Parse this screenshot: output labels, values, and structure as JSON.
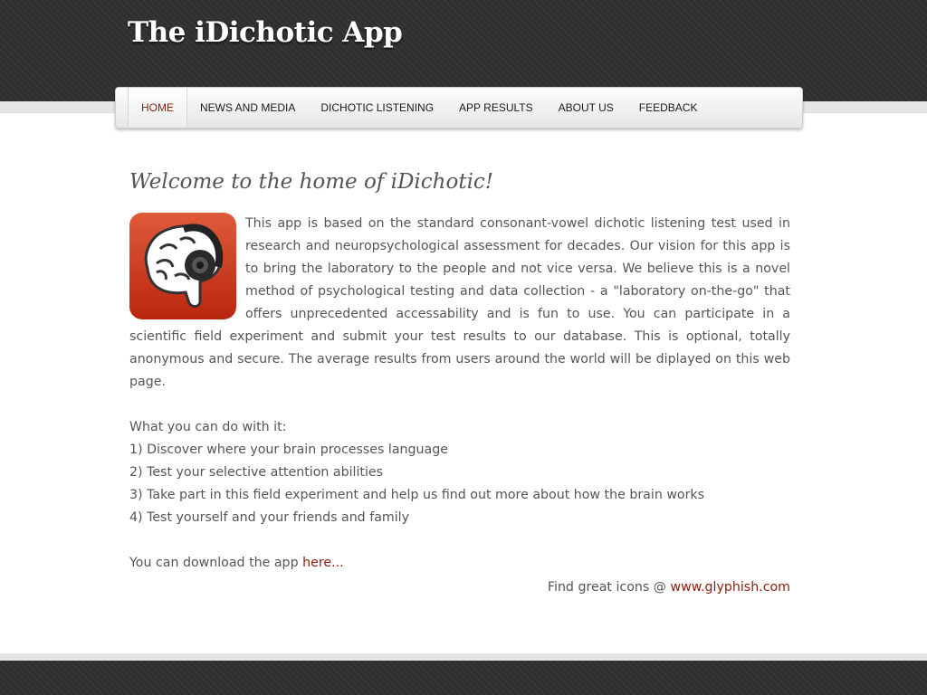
{
  "header": {
    "title": "The iDichotic App"
  },
  "nav": {
    "items": [
      {
        "label": "HOME",
        "active": true
      },
      {
        "label": "NEWS AND MEDIA"
      },
      {
        "label": "DICHOTIC LISTENING"
      },
      {
        "label": "APP RESULTS"
      },
      {
        "label": "ABOUT US"
      },
      {
        "label": "FEEDBACK"
      }
    ]
  },
  "main": {
    "heading": "Welcome to the home of iDichotic!",
    "icon": "brain-headphones-icon",
    "intro": "This app is based on the standard consonant-vowel dichotic listening test used in research and neuropsychological assessment for decades. Our vision for this app is to bring the laboratory to the people and not vice versa. We believe this is a novel method of psychological testing and data collection - a \"laboratory on-the-go\" that offers unprecedented accessability and is fun to use. You can participate in a scientific field experiment and submit your test results to our database. This is optional, totally anonymous and secure. The average results from users around the world will be diplayed on this web page.",
    "list_title": "What you can do with it:",
    "list": [
      "1) Discover where your brain processes language",
      "2) Test your selective attention abilities",
      "3) Take part in this field experiment and help us find out more about how the brain works",
      "4) Test yourself and your friends and family"
    ],
    "download_text": "You can download the app ",
    "download_link": "here...",
    "credit_text": "Find great icons @ ",
    "credit_link": "www.glyphish.com"
  },
  "colors": {
    "header_bg": "#2f2f2f",
    "accent": "#8b1e0b",
    "text": "#555555",
    "icon_red": "#c8321a"
  }
}
